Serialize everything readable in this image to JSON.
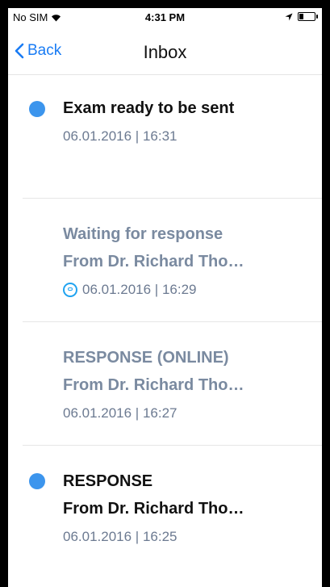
{
  "status_bar": {
    "carrier": "No SIM",
    "time": "4:31 PM"
  },
  "nav": {
    "back_label": "Back",
    "title": "Inbox"
  },
  "colors": {
    "accent": "#1a7cf4",
    "unread_dot": "#3c95ed",
    "muted_text": "#7a8aa0"
  },
  "messages": [
    {
      "title": "Exam ready to be sent",
      "from": "",
      "date": "06.01.2016 | 16:31",
      "unread": true,
      "icon": ""
    },
    {
      "title": "Waiting for response",
      "from": "From Dr. Richard Tho…",
      "date": "06.01.2016 | 16:29",
      "unread": false,
      "icon": "message-status-icon"
    },
    {
      "title": "RESPONSE (ONLINE)",
      "from": "From Dr. Richard Tho…",
      "date": "06.01.2016 | 16:27",
      "unread": false,
      "icon": ""
    },
    {
      "title": "RESPONSE",
      "from": "From Dr. Richard Tho…",
      "date": "06.01.2016 | 16:25",
      "unread": true,
      "icon": ""
    }
  ]
}
